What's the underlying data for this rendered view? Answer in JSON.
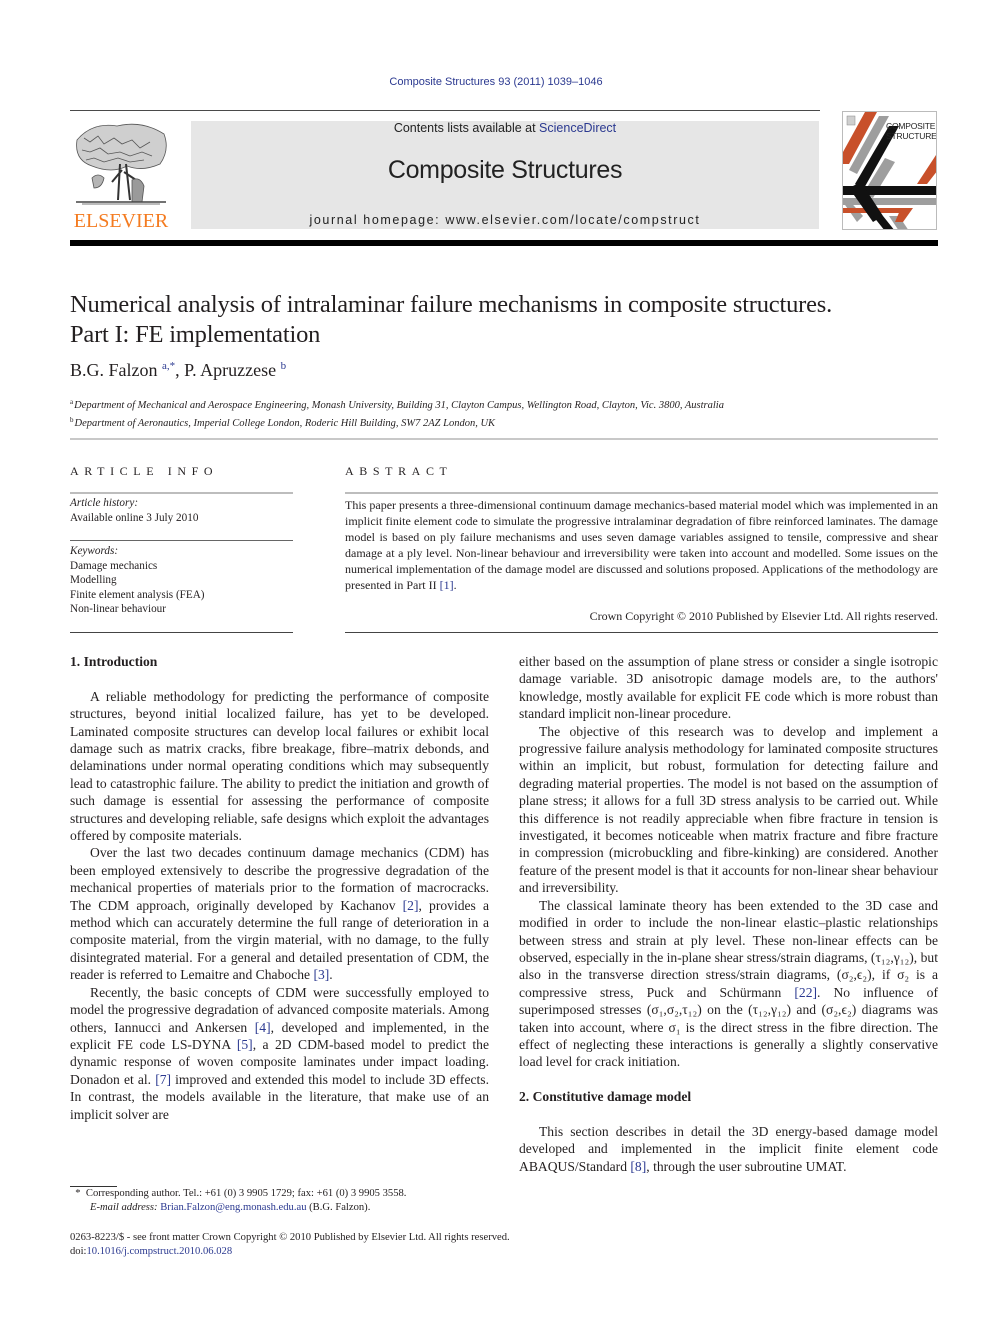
{
  "citation": "Composite Structures 93 (2011) 1039–1046",
  "header": {
    "publisher_logo_text": "ELSEVIER",
    "contents_prefix": "Contents lists available at ",
    "contents_link": "ScienceDirect",
    "journal_title": "Composite Structures",
    "homepage": "journal homepage: www.elsevier.com/locate/compstruct",
    "cover_title_line1": "COMPOSITE",
    "cover_title_line2": "STRUCTURES",
    "colors": {
      "orange": "#f47b20",
      "link_blue": "#2b3990",
      "banner_gray": "#e6e6e6",
      "cover_red": "#c8502a",
      "cover_gray": "#9e9e9e"
    }
  },
  "article": {
    "title_line1": "Numerical analysis of intralaminar failure mechanisms in composite structures.",
    "title_line2": "Part I: FE implementation",
    "authors": [
      {
        "name": "B.G. Falzon",
        "marks": "a,*"
      },
      {
        "name": "P. Apruzzese",
        "marks": "b"
      }
    ],
    "author_separator": ", ",
    "affiliations": [
      {
        "mark": "a",
        "text": "Department of Mechanical and Aerospace Engineering, Monash University, Building 31, Clayton Campus, Wellington Road, Clayton, Vic. 3800, Australia"
      },
      {
        "mark": "b",
        "text": "Department of Aeronautics, Imperial College London, Roderic Hill Building, SW7 2AZ London, UK"
      }
    ]
  },
  "article_info": {
    "heading": "ARTICLE INFO",
    "history_label": "Article history:",
    "history_value": "Available online 3 July 2010",
    "keywords_label": "Keywords:",
    "keywords": [
      "Damage mechanics",
      "Modelling",
      "Finite element analysis (FEA)",
      "Non-linear behaviour"
    ]
  },
  "abstract": {
    "heading": "ABSTRACT",
    "text": "This paper presents a three-dimensional continuum damage mechanics-based material model which was implemented in an implicit finite element code to simulate the progressive intralaminar degradation of fibre reinforced laminates. The damage model is based on ply failure mechanisms and uses seven damage variables assigned to tensile, compressive and shear damage at a ply level. Non-linear behaviour and irreversibility were taken into account and modelled. Some issues on the numerical implementation of the damage model are discussed and solutions proposed. Applications of the methodology are presented in Part II ",
    "ref": "[1]",
    "text_end": ".",
    "copyright": "Crown Copyright © 2010 Published by Elsevier Ltd. All rights reserved."
  },
  "body": {
    "section1_heading": "1. Introduction",
    "p1": "A reliable methodology for predicting the performance of composite structures, beyond initial localized failure, has yet to be developed. Laminated composite structures can develop local failures or exhibit local damage such as matrix cracks, fibre breakage, fibre–matrix debonds, and delaminations under normal operating conditions which may subsequently lead to catastrophic failure. The ability to predict the initiation and growth of such damage is essential for assessing the performance of composite structures and developing reliable, safe designs which exploit the advantages offered by composite materials.",
    "p2": {
      "a": "Over the last two decades continuum damage mechanics (CDM) has been employed extensively to describe the progressive degradation of the mechanical properties of materials prior to the formation of macrocracks. The CDM approach, originally developed by Kachanov ",
      "ref1": "[2]",
      "b": ", provides a method which can accurately determine the full range of deterioration in a composite material, from the virgin material, with no damage, to the fully disintegrated material. For a general and detailed presentation of CDM, the reader is referred to Lemaitre and Chaboche ",
      "ref2": "[3]",
      "c": "."
    },
    "p3": {
      "a": "Recently, the basic concepts of CDM were successfully employed to model the progressive degradation of advanced composite materials. Among others, Iannucci and Ankersen ",
      "ref1": "[4]",
      "b": ", developed and implemented, in the explicit FE code LS-DYNA ",
      "ref2": "[5]",
      "c": ", a 2D CDM-based model to predict the dynamic response of woven composite laminates under impact loading. Donadon et al. ",
      "ref3": "[7]",
      "d": " improved and extended this model to include 3D effects. In contrast, the models available in the literature, that make use of an implicit solver are"
    },
    "p4": "either based on the assumption of plane stress or consider a single isotropic damage variable. 3D anisotropic damage models are, to the authors' knowledge, mostly available for explicit FE code which is more robust than standard implicit non-linear procedure.",
    "p5": "The objective of this research was to develop and implement a progressive failure analysis methodology for laminated composite structures within an implicit, but robust, formulation for detecting failure and degrading material properties. The model is not based on the assumption of plane stress; it allows for a full 3D stress analysis to be carried out. While this difference is not readily appreciable when fibre fracture in tension is investigated, it becomes noticeable when matrix fracture and fibre fracture in compression (microbuckling and fibre-kinking) are considered. Another feature of the present model is that it accounts for non-linear shear behaviour and irreversibility.",
    "p6": {
      "a": "The classical laminate theory has been extended to the 3D case and modified in order to include the non-linear elastic–plastic relationships between stress and strain at ply level. These non-linear effects can be observed, especially in the in-plane shear stress/strain diagrams, (τ₁₂,γ₁₂), but also in the transverse direction stress/strain diagrams, (σ₂,ϵ₂), if σ₂ is a compressive stress, Puck and Schürmann ",
      "ref1": "[22]",
      "b": ". No influence of superimposed stresses (σ₁,σ₂,τ₁₂) on the (τ₁₂,γ₁₂) and (σ₂,ϵ₂) diagrams was taken into account, where σ₁ is the direct stress in the fibre direction. The effect of neglecting these interactions is generally a slightly conservative load level for crack initiation."
    },
    "section2_heading": "2. Constitutive damage model",
    "p7": {
      "a": "This section describes in detail the 3D energy-based damage model developed and implemented in the implicit finite element code ABAQUS/Standard ",
      "ref1": "[8]",
      "b": ", through the user subroutine UMAT."
    }
  },
  "footnote": {
    "mark": "*",
    "corresponding": "Corresponding author. Tel.: +61 (0) 3 9905 1729; fax: +61 (0) 3 9905 3558.",
    "email_label": "E-mail address:",
    "email": "Brian.Falzon@eng.monash.edu.au",
    "email_suffix": " (B.G. Falzon)."
  },
  "front_matter": {
    "issn_line": "0263-8223/$ - see front matter Crown Copyright © 2010 Published by Elsevier Ltd. All rights reserved.",
    "doi_label": "doi:",
    "doi": "10.1016/j.compstruct.2010.06.028"
  }
}
